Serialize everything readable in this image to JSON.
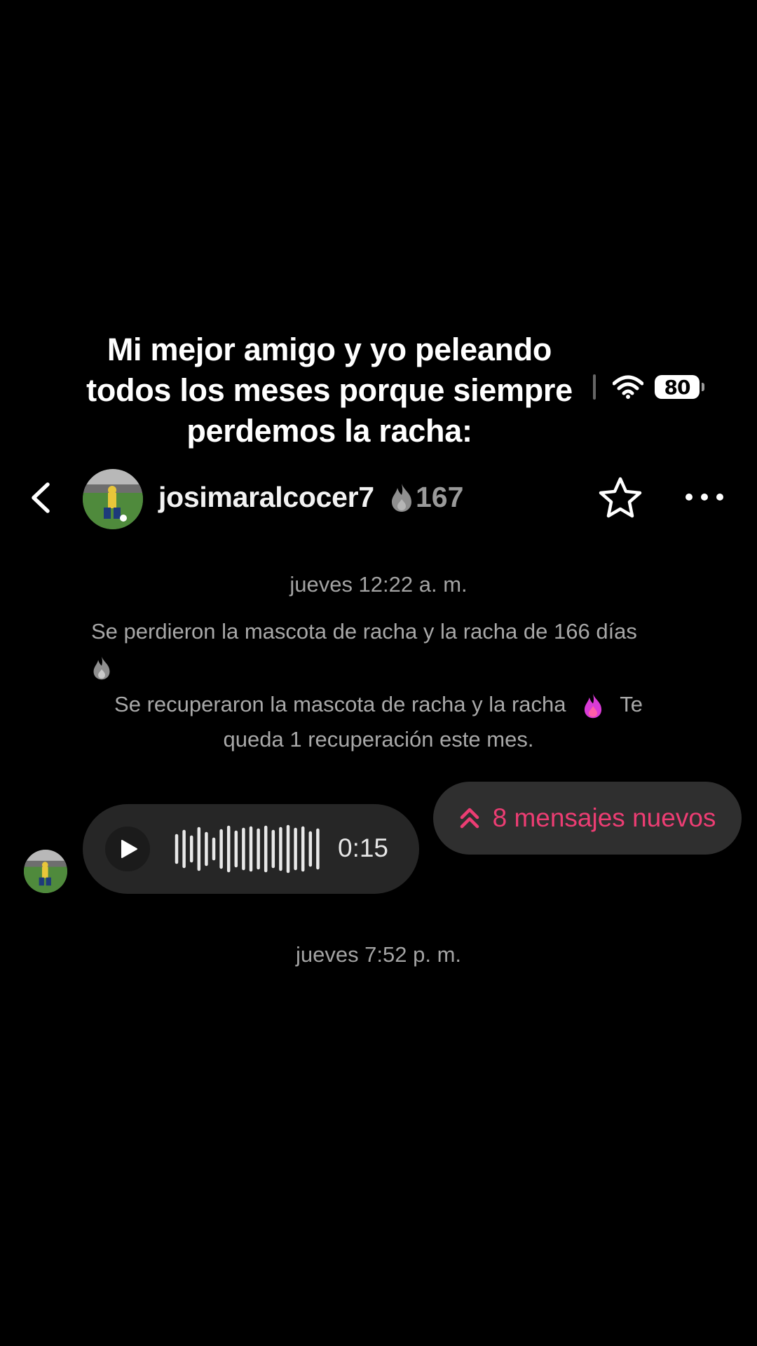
{
  "caption": {
    "line1": "Mi mejor amigo y yo peleando",
    "line2": "todos los meses porque siempre",
    "line3": "perdemos la racha:"
  },
  "status_bar": {
    "battery_level": "80"
  },
  "header": {
    "username": "josimaralcocer7",
    "streak_count": "167",
    "icons": [
      "back-icon",
      "avatar",
      "flame-icon",
      "star-icon",
      "more-icon"
    ]
  },
  "chat": {
    "timestamp_1": "jueves 12:22 a. m.",
    "system_message_1": "Se perdieron la mascota de racha y la racha de 166 días",
    "system_message_2_part1": "Se recuperaron la mascota de racha y la racha",
    "system_message_2_part2": "Te",
    "system_message_2_line2": "queda 1 recuperación este mes.",
    "voice_message": {
      "duration": "0:15"
    },
    "new_messages_label": "8 mensajes nuevos",
    "timestamp_2": "jueves 7:52 p. m."
  },
  "colors": {
    "background": "#000000",
    "accent_pink": "#ec3d73",
    "muted_text": "#a3a3a3",
    "bubble": "#262626"
  }
}
